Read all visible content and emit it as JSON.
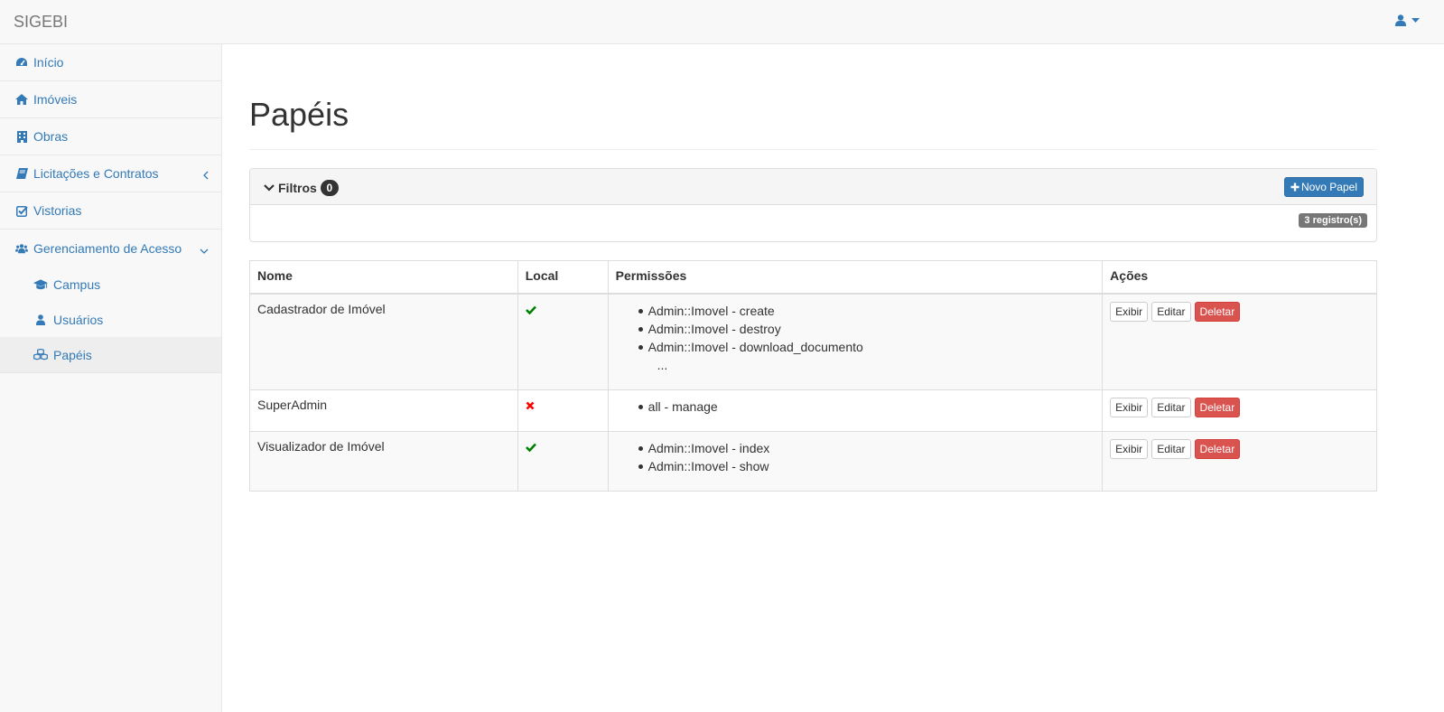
{
  "app": {
    "brand": "SIGEBI"
  },
  "sidebar": {
    "items": [
      {
        "label": "Início",
        "icon": "dashboard-icon"
      },
      {
        "label": "Imóveis",
        "icon": "home-icon"
      },
      {
        "label": "Obras",
        "icon": "building-icon"
      },
      {
        "label": "Licitações e Contratos",
        "icon": "book-icon"
      },
      {
        "label": "Vistorias",
        "icon": "check-square-icon"
      },
      {
        "label": "Gerenciamento de Acesso",
        "icon": "users-icon"
      }
    ],
    "subitems": [
      {
        "label": "Campus",
        "icon": "graduation-cap-icon"
      },
      {
        "label": "Usuários",
        "icon": "user-icon"
      },
      {
        "label": "Papéis",
        "icon": "cubes-icon",
        "active": true
      }
    ]
  },
  "main": {
    "title": "Papéis",
    "filters": {
      "label": "Filtros",
      "count": "0"
    },
    "new_button": "Novo Papel",
    "records": "3 registro(s)",
    "table": {
      "headers": [
        "Nome",
        "Local",
        "Permissões",
        "Ações"
      ],
      "rows": [
        {
          "nome": "Cadastrador de Imóvel",
          "local": true,
          "permissions": [
            "Admin::Imovel - create",
            "Admin::Imovel - destroy",
            "Admin::Imovel - download_documento"
          ],
          "more": "..."
        },
        {
          "nome": "SuperAdmin",
          "local": false,
          "permissions": [
            "all - manage"
          ]
        },
        {
          "nome": "Visualizador de Imóvel",
          "local": true,
          "permissions": [
            "Admin::Imovel - index",
            "Admin::Imovel - show"
          ]
        }
      ],
      "actions": {
        "show": "Exibir",
        "edit": "Editar",
        "delete": "Deletar"
      }
    }
  },
  "colors": {
    "link": "#337ab7",
    "check": "#008000",
    "cross": "#ff0000",
    "danger": "#d9534f"
  }
}
